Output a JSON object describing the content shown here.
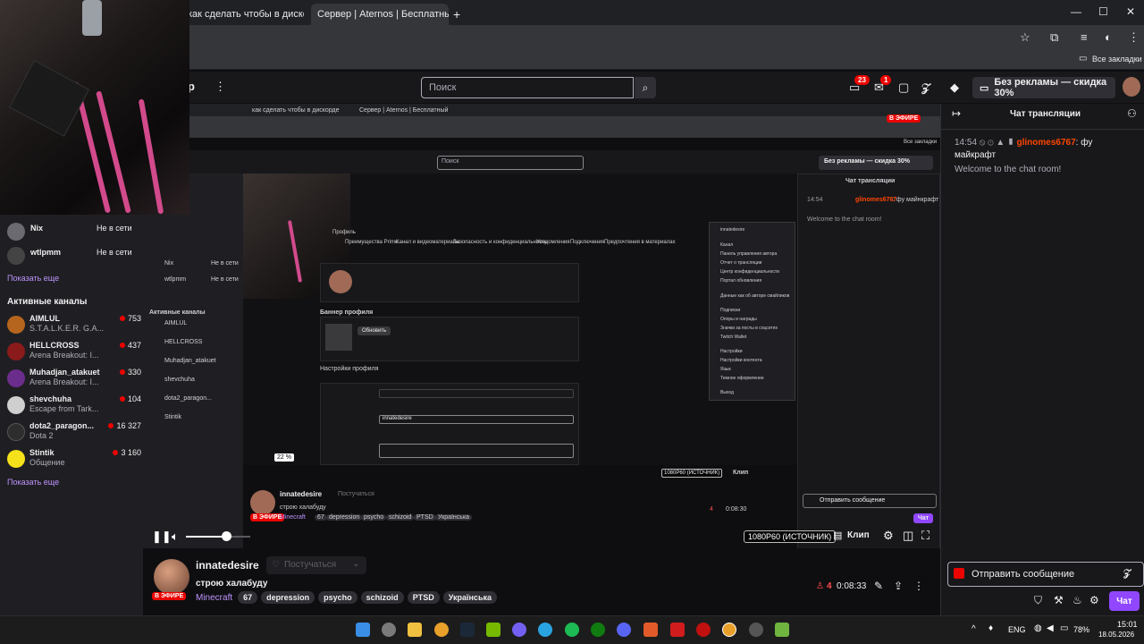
{
  "browser": {
    "tabs": [
      {
        "label": "как сделать чтобы в дискорде"
      },
      {
        "label": "Сервер | Aternos | Бесплатный"
      }
    ],
    "new_tab": "+",
    "window_controls": [
      "—",
      "☐",
      "✕"
    ],
    "bookmarks_all": "Все закладки"
  },
  "twitch_header": {
    "menu_letter": "р",
    "more": "⋮",
    "search_placeholder": "Поиск",
    "notifications_count": "23",
    "inbox_count": "1",
    "ad_free": "Без рекламы — скидка 30%"
  },
  "sidebar": {
    "people": [
      {
        "name": "Nix",
        "status": "Не в сети"
      },
      {
        "name": "wtlpmm",
        "status": "Не в сети"
      }
    ],
    "show_more_1": "Показать еще",
    "active_title": "Активные каналы",
    "channels": [
      {
        "name": "AIMLUL",
        "game": "S.T.A.L.K.E.R. G.A...",
        "viewers": "753",
        "color": "#b5651d"
      },
      {
        "name": "HELLCROSS",
        "game": "Arena Breakout: I...",
        "viewers": "437",
        "color": "#8b1a1a"
      },
      {
        "name": "Muhadjan_atakuet",
        "game": "Arena Breakout: I...",
        "viewers": "330",
        "color": "#6b2d8b"
      },
      {
        "name": "shevchuha",
        "game": "Escape from Tark...",
        "viewers": "104",
        "color": "#cfcfcf"
      },
      {
        "name": "dota2_paragon...",
        "game": "Dota 2",
        "viewers": "16 327",
        "color": "#2d2d2d"
      },
      {
        "name": "Stintik",
        "game": "Общение",
        "viewers": "3 160",
        "color": "#f5e11a"
      }
    ],
    "show_more_2": "Показать еще"
  },
  "nested": {
    "live_badge": "В ЭФИРЕ",
    "chat_title": "Чат трансляции",
    "search": "Поиск",
    "ad_free": "Без рекламы — скидка 30%",
    "bookmarks_all": "Все закладки",
    "chat_time": "14:54",
    "chat_user": "glinomes6767",
    "chat_msg": ": фу майнкрафт",
    "chat_welcome": "Welcome to the chat room!",
    "send_placeholder": "Отправить сообщение",
    "chat_btn": "Чат",
    "quality": "1080P60 (ИСТОЧНИК)",
    "clip": "Клип",
    "volume_tip": "22 %",
    "streamer": "innatedesire",
    "follow": "Постучаться",
    "title": "строю халабуду",
    "game": "Minecraft",
    "tags": [
      "67",
      "depression",
      "psycho",
      "schizoid",
      "PTSD",
      "Українська"
    ],
    "viewers": "4",
    "uptime": "0:08:30",
    "settings_tabs": [
      "Профиль",
      "Преимущества Prime",
      "Канал и видеоматериалы",
      "Безопасность и конфиденциальность",
      "Уведомления",
      "Подключения",
      "Предпочтения в материалах"
    ],
    "banner_title": "Баннер профиля",
    "profile_settings": "Настройки профиля",
    "update_btn": "Обновить",
    "menu_items": [
      "innatedesire",
      "Канал",
      "Панель управления автора",
      "Отчет о трансляции",
      "Центр конфиденциальности",
      "Портал обновления",
      "Данные как об авторе смайликов",
      "Подписки",
      "Опоры и награды",
      "Значки за посты в соцсетях",
      "Twitch Wallet",
      "Настройки",
      "Настройки контента",
      "Язык",
      "Темное оформление",
      "Выход"
    ]
  },
  "player": {
    "quality": "1080P60 (ИСТОЧНИК)",
    "clip": "Клип"
  },
  "channel": {
    "streamer": "innatedesire",
    "follow": "Постучаться",
    "title": "строю халабуду",
    "live_badge": "В ЭФИРЕ",
    "game": "Minecraft",
    "tags": [
      "67",
      "depression",
      "psycho",
      "schizoid",
      "PTSD",
      "Українська"
    ],
    "viewers": "4",
    "uptime": "0:08:33"
  },
  "chat": {
    "title": "Чат трансляции",
    "time": "14:54",
    "user": "glinomes6767",
    "message": ": фу майкрафт",
    "welcome": "Welcome to the chat room!",
    "input_placeholder": "Отправить сообщение",
    "send_button": "Чат"
  },
  "taskbar": {
    "lang": "ENG",
    "battery": "78%",
    "time": "15:01",
    "date": "18.05.2026",
    "up_arrow": "^"
  },
  "colors": {
    "accent": "#9147ff",
    "live": "#eb0400",
    "username": "#ff4500",
    "link": "#bf94ff"
  }
}
